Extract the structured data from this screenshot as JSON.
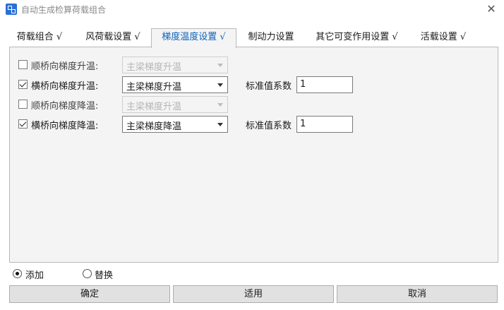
{
  "window": {
    "title": "自动生成检算荷载组合",
    "close_glyph": "✕"
  },
  "tabs": [
    {
      "label": "荷载组合 √",
      "active": false
    },
    {
      "label": "风荷载设置 √",
      "active": false
    },
    {
      "label": "梯度温度设置 √",
      "active": true
    },
    {
      "label": "制动力设置",
      "active": false
    },
    {
      "label": "其它可变作用设置 √",
      "active": false
    },
    {
      "label": "活载设置 √",
      "active": false
    }
  ],
  "rows": [
    {
      "label": "顺桥向梯度升温:",
      "checked": false,
      "select_value": "主梁梯度升温",
      "enabled": false
    },
    {
      "label": "横桥向梯度升温:",
      "checked": true,
      "select_value": "主梁梯度升温",
      "enabled": true,
      "coef_label": "标准值系数",
      "coef_value": "1"
    },
    {
      "label": "顺桥向梯度降温:",
      "checked": false,
      "select_value": "主梁梯度升温",
      "enabled": false
    },
    {
      "label": "横桥向梯度降温:",
      "checked": true,
      "select_value": "主梁梯度降温",
      "enabled": true,
      "coef_label": "标准值系数",
      "coef_value": "1"
    }
  ],
  "mode": {
    "options": [
      {
        "label": "添加",
        "selected": true
      },
      {
        "label": "替换",
        "selected": false
      }
    ]
  },
  "buttons": {
    "ok": "确定",
    "apply": "适用",
    "cancel": "取消"
  },
  "colors": {
    "active_tab_text": "#0a63b8",
    "panel_bg": "#f4f4f4",
    "app_icon": "#2a6fd6"
  },
  "icons": {
    "app": "app-icon",
    "close": "close-icon",
    "dropdown": "chevron-down-icon"
  }
}
